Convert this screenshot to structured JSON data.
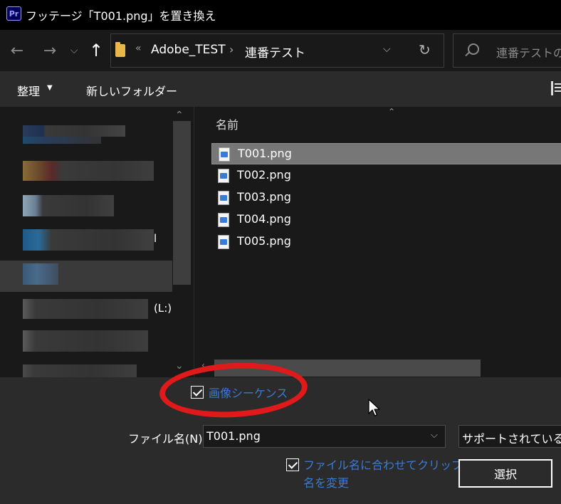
{
  "window": {
    "app_icon_text": "Pr",
    "title": "フッテージ「T001.png」を置き換え"
  },
  "address_bar": {
    "overflow": "«",
    "breadcrumbs": [
      "Adobe_TEST",
      "連番テスト"
    ],
    "separator": "›",
    "search_placeholder": "連番テストの"
  },
  "toolbar": {
    "organize_label": "整理",
    "new_folder_label": "新しいフォルダー"
  },
  "nav_pane": {
    "items": [
      {
        "suffix": ""
      },
      {
        "suffix": ""
      },
      {
        "suffix": ""
      },
      {
        "suffix": "l"
      },
      {
        "suffix": ""
      },
      {
        "suffix": "(L:)"
      },
      {
        "suffix": ""
      },
      {
        "suffix": ""
      }
    ]
  },
  "file_list": {
    "column_header": "名前",
    "files": [
      "T001.png",
      "T002.png",
      "T003.png",
      "T004.png",
      "T005.png"
    ],
    "selected_index": 0
  },
  "options": {
    "image_sequence_label": "画像シーケンス",
    "image_sequence_checked": true,
    "file_name_label": "ファイル名(N):",
    "file_name_value": "T001.png",
    "file_type_value": "サポートされているす",
    "rename_clip_label_line1": "ファイル名に合わせてクリップ",
    "rename_clip_label_line2": "名を変更",
    "rename_clip_checked": true,
    "select_button_label": "選択"
  },
  "colors": {
    "link_blue": "#3b7bd0",
    "highlight_circle": "#e01a1a",
    "selected_row": "#777777"
  }
}
